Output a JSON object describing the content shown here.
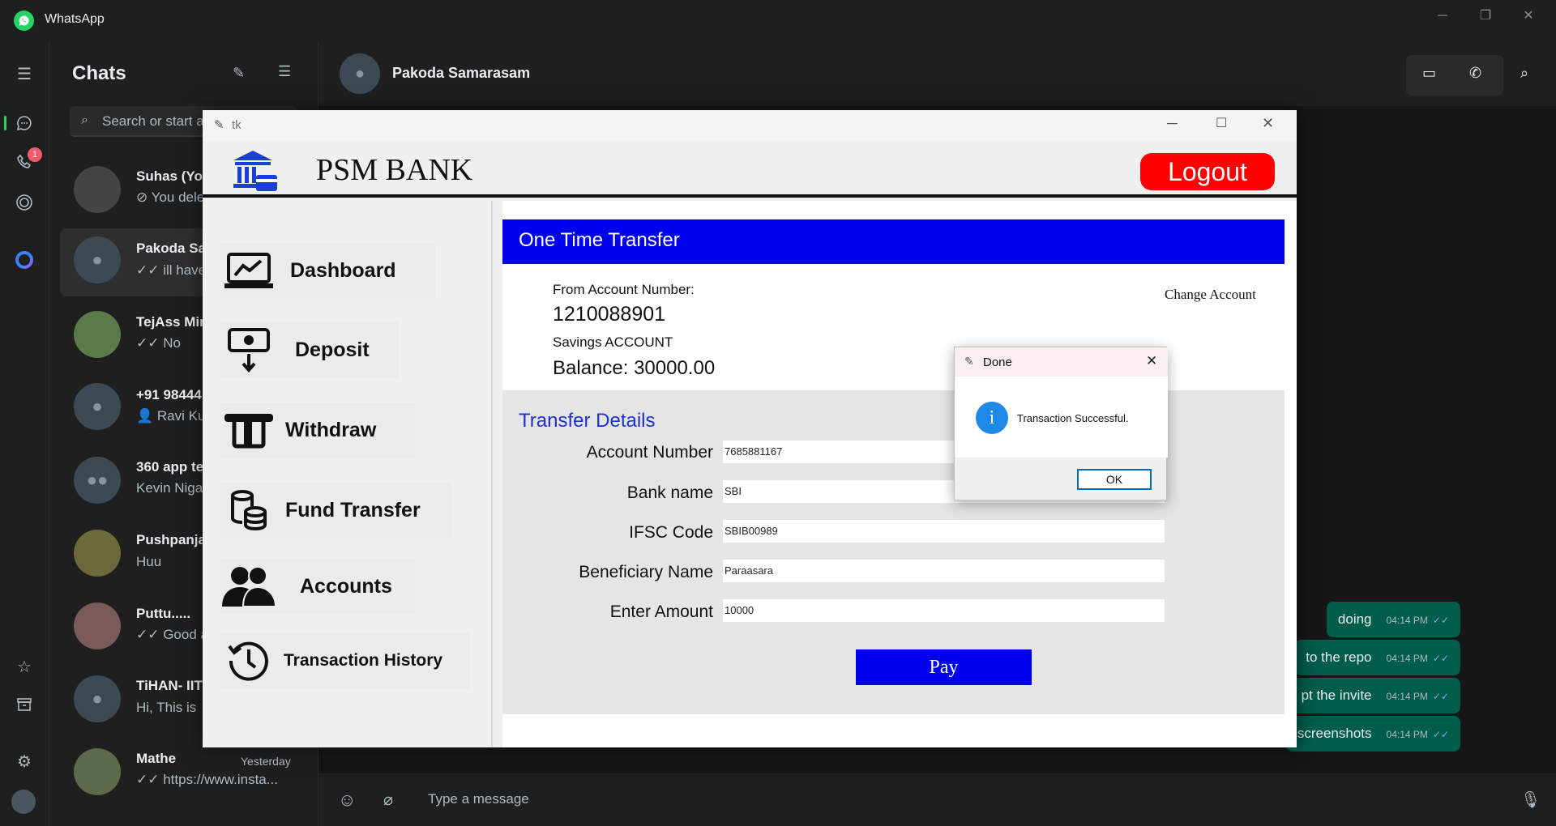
{
  "window": {
    "title": "WhatsApp",
    "controls": [
      "minimize",
      "restore",
      "close"
    ]
  },
  "rail": {
    "icons": [
      "menu-icon",
      "chats-icon",
      "calls-icon",
      "status-icon",
      "meta-ai-icon",
      "starred-icon",
      "archive-icon",
      "settings-icon",
      "profile-avatar"
    ],
    "call_badge": "1"
  },
  "chatlist": {
    "title": "Chats",
    "search_placeholder": "Search or start a",
    "chats": [
      {
        "name": "Suhas (Yo...",
        "preview": "⊘ You dele"
      },
      {
        "name": "Pakoda Sa",
        "preview": "✓✓ ill have"
      },
      {
        "name": "TejAss Mir",
        "preview": "✓✓ No"
      },
      {
        "name": "+91 98444",
        "preview": "👤 Ravi Ku"
      },
      {
        "name": "360 app te",
        "preview": "Kevin Niga"
      },
      {
        "name": "Pushpanja",
        "preview": "Huu"
      },
      {
        "name": "Puttu.....",
        "preview": "✓✓ Good a"
      },
      {
        "name": "TiHAN- IIT",
        "preview": "Hi,  This is"
      },
      {
        "name": "Mathe",
        "preview": "✓✓ https://www.insta...",
        "time": "Yesterday"
      }
    ]
  },
  "conversation": {
    "contact_name": "Pakoda Samarasam",
    "messages": [
      {
        "text": "doing",
        "time": "04:14 PM"
      },
      {
        "text": "to the repo",
        "time": "04:14 PM"
      },
      {
        "text": "pt the invite",
        "time": "04:14 PM"
      },
      {
        "text": "screenshots",
        "time": "04:14 PM"
      }
    ],
    "compose_placeholder": "Type a message"
  },
  "tk": {
    "title": "tk",
    "bank_name": "PSM BANK",
    "logout_label": "Logout",
    "nav": [
      "Dashboard",
      "Deposit",
      "Withdraw",
      "Fund Transfer",
      "Accounts",
      "Transaction History"
    ],
    "ott_title": "One Time Transfer",
    "from_label": "From Account Number:",
    "account_number": "1210088901",
    "account_type": "Savings ACCOUNT",
    "balance": "Balance: 30000.00",
    "change_account": "Change Account",
    "transfer_title": "Transfer Details",
    "fields": [
      {
        "label": "Account Number",
        "value": "7685881167"
      },
      {
        "label": "Bank name",
        "value": "SBI"
      },
      {
        "label": "IFSC Code",
        "value": "SBIB00989"
      },
      {
        "label": "Beneficiary Name",
        "value": "Paraasara"
      },
      {
        "label": "Enter Amount",
        "value": "10000"
      }
    ],
    "pay_label": "Pay"
  },
  "dialog": {
    "title": "Done",
    "message": "Transaction Successful.",
    "ok_label": "OK"
  },
  "colors": {
    "whatsapp_green": "#25d366",
    "bubble": "#005c4b",
    "bank_blue": "#0000ee",
    "logout_red": "#ff0000"
  }
}
